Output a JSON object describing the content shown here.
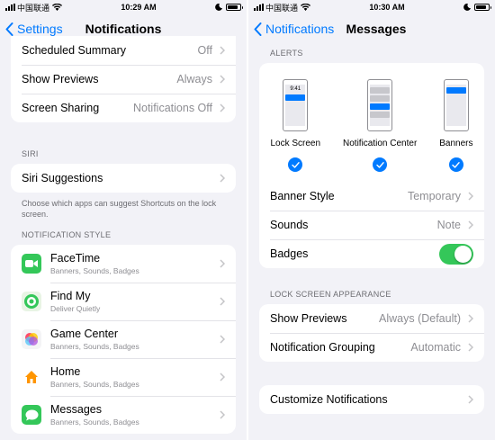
{
  "left": {
    "status": {
      "carrier": "中国联通",
      "time": "10:29 AM"
    },
    "nav": {
      "back_label": "Settings",
      "title": "Notifications"
    },
    "top_rows": [
      {
        "label": "Scheduled Summary",
        "value": "Off"
      },
      {
        "label": "Show Previews",
        "value": "Always"
      },
      {
        "label": "Screen Sharing",
        "value": "Notifications Off"
      }
    ],
    "siri": {
      "header": "SIRI",
      "row_label": "Siri Suggestions",
      "footnote": "Choose which apps can suggest Shortcuts on the lock screen."
    },
    "notification_style_header": "NOTIFICATION STYLE",
    "apps": [
      {
        "name": "FaceTime",
        "sub": "Banners, Sounds, Badges",
        "icon": "facetime-icon",
        "color": "#34c759"
      },
      {
        "name": "Find My",
        "sub": "Deliver Quietly",
        "icon": "find-my-icon",
        "color": "#34c759"
      },
      {
        "name": "Game Center",
        "sub": "Banners, Sounds, Badges",
        "icon": "game-center-icon",
        "color": "#ff2d55"
      },
      {
        "name": "Home",
        "sub": "Banners, Sounds, Badges",
        "icon": "home-icon",
        "color": "#ff9500"
      },
      {
        "name": "Messages",
        "sub": "Banners, Sounds, Badges",
        "icon": "messages-icon",
        "color": "#34c759"
      }
    ]
  },
  "right": {
    "status": {
      "carrier": "中国联通",
      "time": "10:30 AM"
    },
    "nav": {
      "back_label": "Notifications",
      "title": "Messages"
    },
    "alerts_header": "ALERTS",
    "alert_options": [
      {
        "label": "Lock Screen",
        "checked": true,
        "clock": "9:41"
      },
      {
        "label": "Notification Center",
        "checked": true
      },
      {
        "label": "Banners",
        "checked": true
      }
    ],
    "alert_rows": [
      {
        "label": "Banner Style",
        "value": "Temporary"
      },
      {
        "label": "Sounds",
        "value": "Note"
      }
    ],
    "badges": {
      "label": "Badges",
      "on": true
    },
    "lock_screen_header": "LOCK SCREEN APPEARANCE",
    "lock_rows": [
      {
        "label": "Show Previews",
        "value": "Always (Default)"
      },
      {
        "label": "Notification Grouping",
        "value": "Automatic"
      }
    ],
    "customize_label": "Customize Notifications"
  },
  "colors": {
    "accent": "#007aff",
    "toggle_on": "#34c759",
    "background": "#f2f2f7",
    "secondary_text": "#8e8e93"
  }
}
